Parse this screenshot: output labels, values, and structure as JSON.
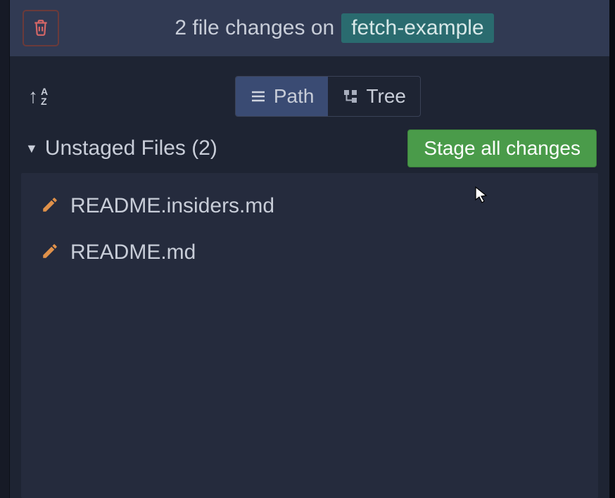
{
  "header": {
    "changes_prefix": "2 file changes on",
    "branch_name": "fetch-example"
  },
  "toolbar": {
    "sort_a": "A",
    "sort_z": "Z",
    "view_path_label": "Path",
    "view_tree_label": "Tree"
  },
  "section": {
    "title": "Unstaged Files (2)",
    "stage_all_label": "Stage all changes"
  },
  "files": [
    {
      "name": "README.insiders.md"
    },
    {
      "name": "README.md"
    }
  ]
}
